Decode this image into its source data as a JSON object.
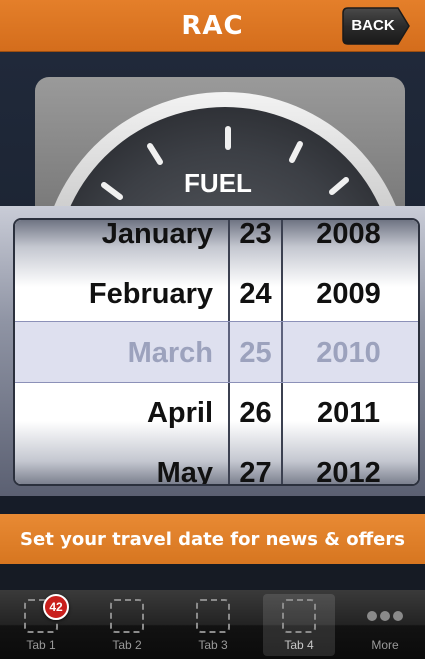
{
  "header": {
    "logo_text": "RAC",
    "back_label": "BACK"
  },
  "gauge": {
    "label": "FUEL"
  },
  "picker": {
    "months": [
      "January",
      "February",
      "March",
      "April",
      "May"
    ],
    "days": [
      "23",
      "24",
      "25",
      "26",
      "27"
    ],
    "years": [
      "2008",
      "2009",
      "2010",
      "2011",
      "2012"
    ],
    "selected": {
      "month": "March",
      "day": "25",
      "year": "2010"
    }
  },
  "banner": {
    "text": "Set your travel date for news & offers"
  },
  "tabbar": {
    "tabs": [
      {
        "label": "Tab 1",
        "badge": "42"
      },
      {
        "label": "Tab 2"
      },
      {
        "label": "Tab 3"
      },
      {
        "label": "Tab 4"
      },
      {
        "label": "More"
      }
    ],
    "active_tab": "Tab 4"
  },
  "colors": {
    "brand_orange": "#e07a24",
    "needle": "#e8481c",
    "badge_red": "#c9201d"
  }
}
